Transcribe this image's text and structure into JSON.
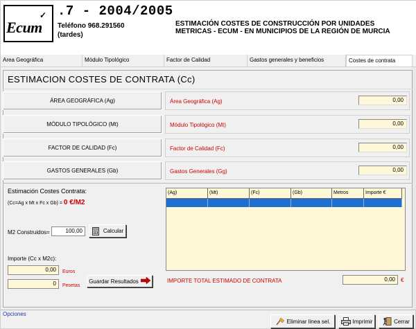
{
  "header": {
    "logo_text": "Ecum",
    "title": ".7 - 2004/2005",
    "phone_line1": "Teléfono 968.291560",
    "phone_line2": "(tardes)",
    "desc_line1": "ESTIMACIÓN COSTES DE CONSTRUCCIÓN POR UNIDADES",
    "desc_line2": "METRICAS - ECUM - EN MUNICIPIOS DE LA REGIÓN DE MURCIA"
  },
  "tabs": [
    {
      "label": "Area Geográfica"
    },
    {
      "label": "Módulo Tipológico"
    },
    {
      "label": "Factor de Calidad"
    },
    {
      "label": "Gastos generales y beneficios"
    },
    {
      "label": "Costes de contrata"
    }
  ],
  "panel": {
    "title": "ESTIMACION COSTES DE CONTRATA (Cc)",
    "rows": [
      {
        "left": "ÁREA GEOGRÁFICA (Ag)",
        "right": "Área Geográfica (Ag)",
        "value": "0,00"
      },
      {
        "left": "MÓDULO TIPOLÓGICO (Mt)",
        "right": "Módulo Tipológico (Mt)",
        "value": "0,00"
      },
      {
        "left": "FACTOR DE CALIDAD (Fc)",
        "right": "Factor de Calidad (Fc)",
        "value": "0,00"
      },
      {
        "left": "GASTOS GENERALES (Gb)",
        "right": "Gastos Generales (Gg)",
        "value": "0,00"
      }
    ]
  },
  "estimate": {
    "title": "Estimación Costes Contrata:",
    "formula": "(Cc=Ag x Mt x Fc x Gb) =",
    "result": "0 €/M2",
    "m2_label": "M2 Construidos=",
    "m2_value": "100,00",
    "calc_label": "Calcular",
    "importe_label": "Importe (Cc x M2c):",
    "euros_value": "0,00",
    "euros_unit": "Euros",
    "pesetas_value": "0",
    "pesetas_unit": "Pesetas",
    "save_label": "Guardar Resultados"
  },
  "grid": {
    "columns": [
      "(Ag)",
      "(Mt)",
      "(Fc)",
      "(Gb)",
      "Metros",
      "Importe €"
    ]
  },
  "total": {
    "label": "IMPORTE TOTAL ESTIMADO DE CONTRATA",
    "value": "0,00",
    "unit": "€"
  },
  "footer": {
    "opciones": "Opciones",
    "delete_label": "Eliminar linea sel.",
    "print_label": "Imprimir",
    "close_label": "Cerrar"
  }
}
